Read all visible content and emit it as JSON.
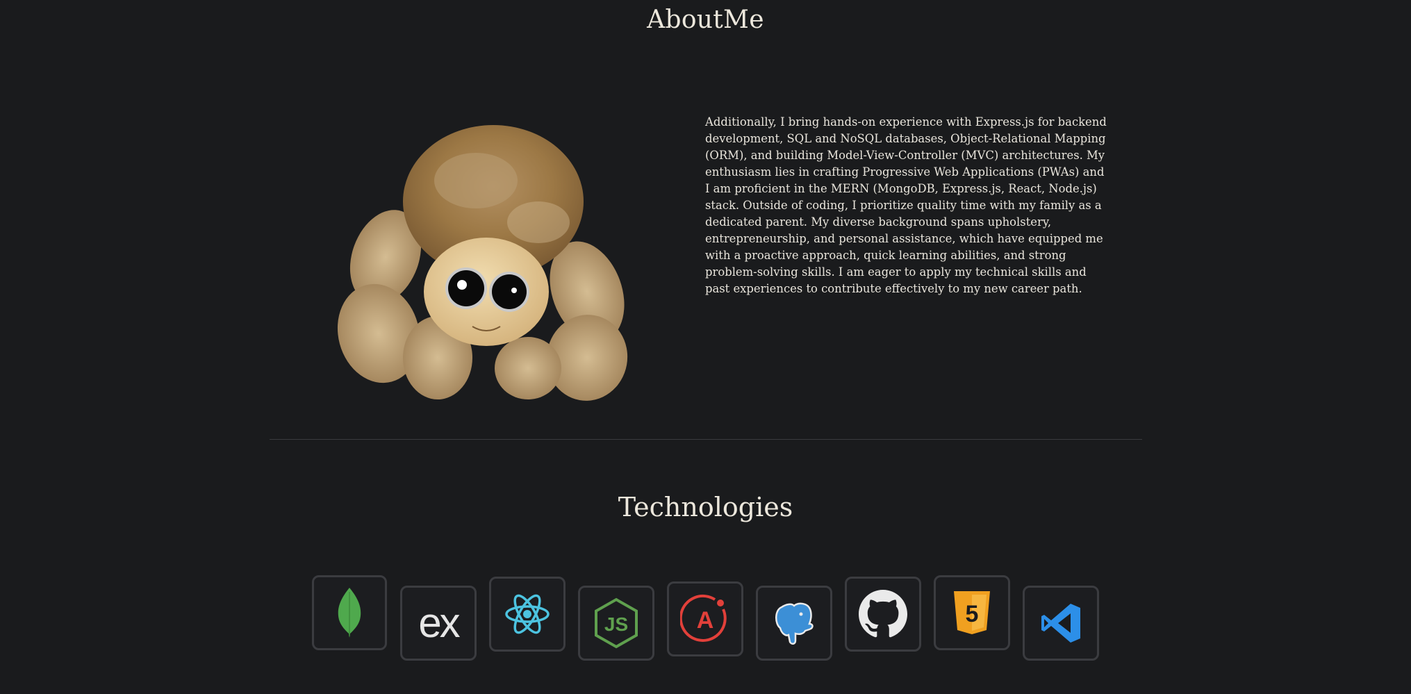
{
  "about": {
    "title": "AboutMe",
    "paragraph": "Additionally, I bring hands-on experience with Express.js for backend development, SQL and NoSQL databases, Object-Relational Mapping (ORM), and building Model-View-Controller (MVC) architectures. My enthusiasm lies in crafting Progressive Web Applications (PWAs) and I am proficient in the MERN (MongoDB, Express.js, React, Node.js) stack. Outside of coding, I prioritize quality time with my family as a dedicated parent. My diverse background spans upholstery, entrepreneurship, and personal assistance, which have equipped me with a proactive approach, quick learning abilities, and strong problem-solving skills. I am eager to apply my technical skills and past experiences to contribute effectively to my new career path.",
    "image": "plush-spider-photo"
  },
  "technologies": {
    "title": "Technologies",
    "icons": [
      {
        "name": "mongodb-icon",
        "color": "#4fa94d"
      },
      {
        "name": "express-icon",
        "label": "ex",
        "color": "#e6e6e6"
      },
      {
        "name": "react-icon",
        "color": "#4cc3e0"
      },
      {
        "name": "nodejs-icon",
        "label": "JS",
        "color": "#5fa04e"
      },
      {
        "name": "apollo-icon",
        "label": "A",
        "color": "#e2403a"
      },
      {
        "name": "postgresql-icon",
        "color": "#3c8fd6"
      },
      {
        "name": "github-icon",
        "color": "#eaeaea"
      },
      {
        "name": "html5-icon",
        "label": "5",
        "color": "#f0a020"
      },
      {
        "name": "vscode-icon",
        "color": "#2c8fe8"
      }
    ]
  },
  "colors": {
    "background": "#1a1b1d",
    "text": "#e8e4da",
    "tile_border": "#3b3c40"
  }
}
